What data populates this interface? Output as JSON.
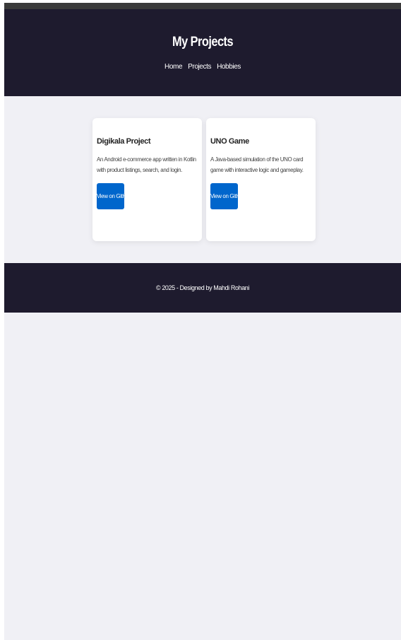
{
  "header": {
    "title": "My Projects",
    "nav": [
      "Home",
      "Projects",
      "Hobbies"
    ]
  },
  "projects": [
    {
      "title": "Digikala Project",
      "description": "An Android e-commerce app written in Kotlin with product listings, search, and login.",
      "button_label": "View on GitHub"
    },
    {
      "title": "UNO Game",
      "description": "A Java-based simulation of the UNO card game with interactive logic and gameplay.",
      "button_label": "View on GitHub"
    }
  ],
  "footer": {
    "text": "© 2025 - Designed by Mahdi Rohani"
  },
  "colors": {
    "header_bg": "#1e1b2e",
    "page_bg": "#f0f0f5",
    "button_bg": "#0066cc",
    "card_bg": "#ffffff"
  }
}
